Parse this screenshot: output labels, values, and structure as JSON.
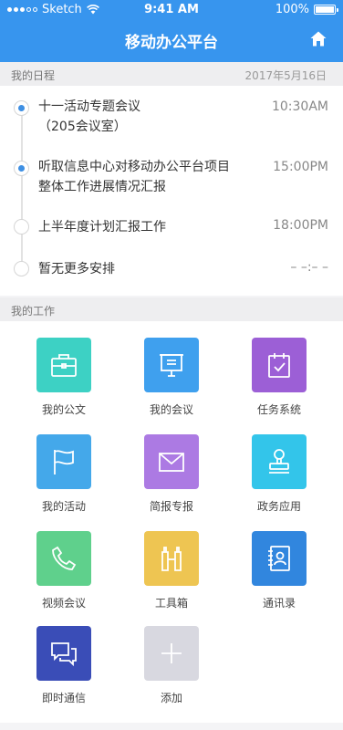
{
  "status_bar": {
    "carrier": "Sketch",
    "time": "9:41 AM",
    "battery": "100%"
  },
  "nav": {
    "title": "移动办公平台",
    "home_icon": "home-icon"
  },
  "schedule": {
    "section_label": "我的日程",
    "date": "2017年5月16日",
    "items": [
      {
        "line1": "十一活动专题会议",
        "line2": "（205会议室）",
        "time": "10:30AM",
        "active": true
      },
      {
        "line1": "听取信息中心对移动办公平台项目",
        "line2": "整体工作进展情况汇报",
        "time": "15:00PM",
        "active": true
      },
      {
        "line1": "上半年度计划汇报工作",
        "line2": "",
        "time": "18:00PM",
        "active": false
      },
      {
        "line1": "暂无更多安排",
        "line2": "",
        "time": "– –:– –",
        "active": false
      }
    ]
  },
  "work": {
    "section_label": "我的工作",
    "apps": [
      {
        "label": "我的公文",
        "icon": "briefcase-icon",
        "color": "#3dd1c4"
      },
      {
        "label": "我的会议",
        "icon": "presentation-icon",
        "color": "#3fa0ee"
      },
      {
        "label": "任务系统",
        "icon": "task-check-icon",
        "color": "#9c5fd6"
      },
      {
        "label": "我的活动",
        "icon": "flag-icon",
        "color": "#44a8ea"
      },
      {
        "label": "简报专报",
        "icon": "envelope-icon",
        "color": "#ac7ae3"
      },
      {
        "label": "政务应用",
        "icon": "stamp-icon",
        "color": "#33c5ea"
      },
      {
        "label": "视频会议",
        "icon": "phone-icon",
        "color": "#5fd08c"
      },
      {
        "label": "工具箱",
        "icon": "toolbox-icon",
        "color": "#eec552"
      },
      {
        "label": "通讯录",
        "icon": "contacts-icon",
        "color": "#3186de"
      },
      {
        "label": "即时通信",
        "icon": "chat-icon",
        "color": "#3a4db7"
      },
      {
        "label": "添加",
        "icon": "plus-icon",
        "color": "#d8d8e0"
      }
    ]
  }
}
